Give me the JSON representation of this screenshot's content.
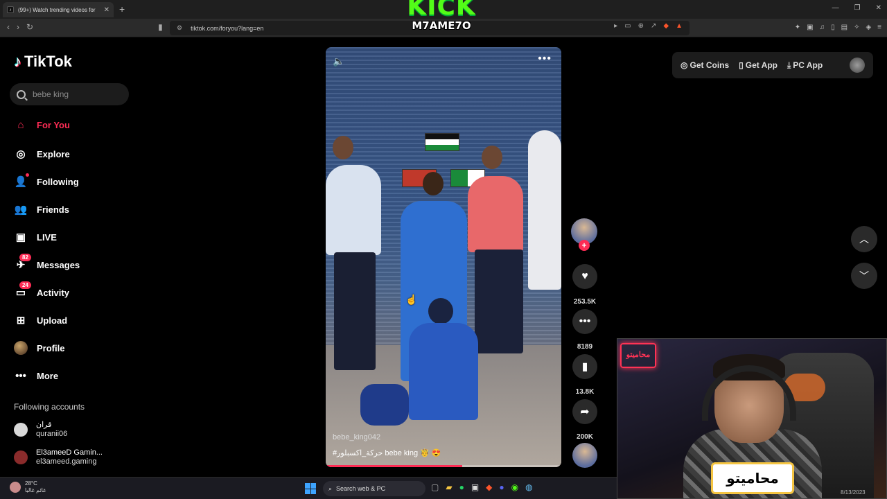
{
  "browser": {
    "tab_title": "(99+) Watch trending videos for",
    "tab_close": "✕",
    "new_tab": "+",
    "url": "tiktok.com/foryou?lang=en"
  },
  "overlay": {
    "kick_top": "KICK",
    "kick_bottom": "M7AME7O"
  },
  "tiktok": {
    "logo": "TikTok",
    "search_placeholder": "bebe king",
    "menu": [
      {
        "label": "For You",
        "active": true
      },
      {
        "label": "Explore"
      },
      {
        "label": "Following"
      },
      {
        "label": "Friends"
      },
      {
        "label": "LIVE"
      },
      {
        "label": "Messages",
        "badge": "82"
      },
      {
        "label": "Activity",
        "badge": "24"
      },
      {
        "label": "Upload"
      },
      {
        "label": "Profile"
      },
      {
        "label": "More"
      }
    ],
    "following_title": "Following accounts",
    "following": [
      {
        "name": "قران",
        "handle": "quranii06"
      },
      {
        "name": "El3ameeD Gamin...",
        "handle": "el3ameed.gaming"
      }
    ],
    "top_actions": {
      "coins": "Get Coins",
      "app": "Get App",
      "pc": "PC App"
    }
  },
  "video": {
    "username": "bebe_king042",
    "caption": "#حركة_اكسبلور bebe king 🤴 😍",
    "progress": 0.58,
    "likes": "253.5K",
    "comments": "8189",
    "saves": "13.8K",
    "shares": "200K"
  },
  "webcam": {
    "logo_text": "محاميتو",
    "neon_text": "محاميتو"
  },
  "taskbar": {
    "temp": "28°C",
    "weather_text": "غائم غالبا",
    "search_label": "Search web & PC",
    "date": "8/13/2023"
  },
  "colors": {
    "accent": "#fe2c55",
    "kick_green": "#53fc18"
  }
}
